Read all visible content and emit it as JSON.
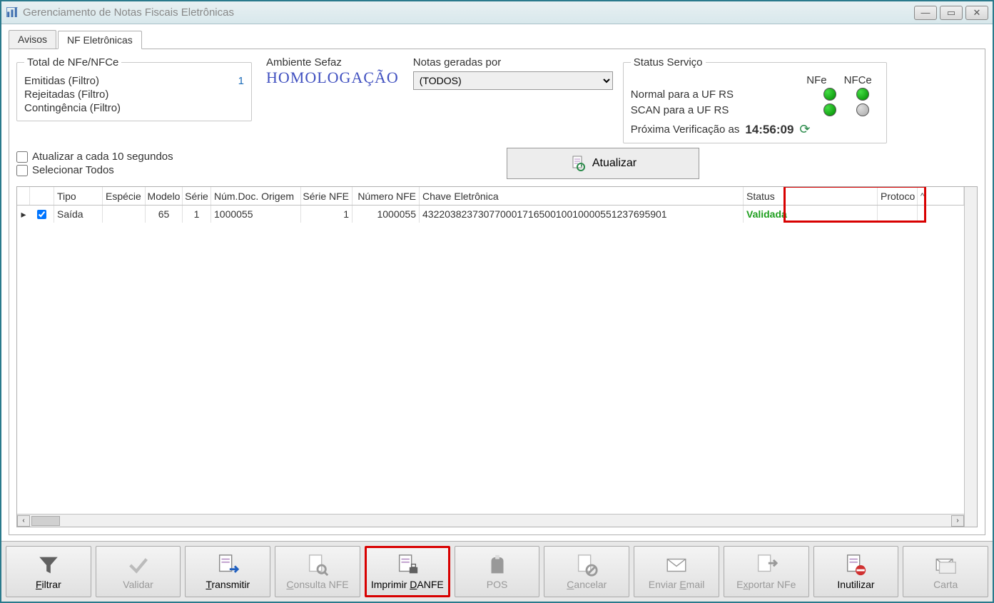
{
  "window": {
    "title": "Gerenciamento de Notas Fiscais Eletrônicas"
  },
  "tabs": {
    "avisos": "Avisos",
    "nfe": "NF Eletrônicas"
  },
  "totals": {
    "legend": "Total de NFe/NFCe",
    "emitidas_label": "Emitidas (Filtro)",
    "emitidas_val": "1",
    "rejeitadas_label": "Rejeitadas (Filtro)",
    "contingencia_label": "Contingência (Filtro)"
  },
  "ambiente": {
    "label": "Ambiente Sefaz",
    "value": "HOMOLOGAÇÃO"
  },
  "notas": {
    "label": "Notas geradas por",
    "selected": "(TODOS)"
  },
  "status_servico": {
    "legend": "Status Serviço",
    "col_nfe": "NFe",
    "col_nfce": "NFCe",
    "normal_label": "Normal para a UF RS",
    "scan_label": "SCAN para a UF RS",
    "proxima_label": "Próxima Verificação as",
    "proxima_time": "14:56:09"
  },
  "checks": {
    "auto_refresh": "Atualizar a cada 10 segundos",
    "select_all": "Selecionar Todos"
  },
  "buttons": {
    "atualizar": "Atualizar"
  },
  "grid": {
    "headers": {
      "tipo": "Tipo",
      "especie": "Espécie",
      "modelo": "Modelo",
      "serie": "Série",
      "numdoc": "Núm.Doc. Origem",
      "serienfe": "Série NFE",
      "numnfe": "Número NFE",
      "chave": "Chave Eletrônica",
      "status": "Status",
      "protoc": "Protoco"
    },
    "rows": [
      {
        "checked": true,
        "tipo": "Saída",
        "especie": "",
        "modelo": "65",
        "serie": "1",
        "numdoc": "1000055",
        "serienfe": "1",
        "numnfe": "1000055",
        "chave": "43220382373077000171650010010000551237695901",
        "status": "Validada"
      }
    ]
  },
  "toolbar": {
    "filtrar": "Filtrar",
    "validar": "Validar",
    "transmitir": "Transmitir",
    "consulta": "Consulta NFE",
    "imprimir": "Imprimir DANFE",
    "pos": "POS",
    "cancelar": "Cancelar",
    "email": "Enviar Email",
    "exportar": "Exportar NFe",
    "inutilizar": "Inutilizar",
    "carta": "Carta"
  }
}
